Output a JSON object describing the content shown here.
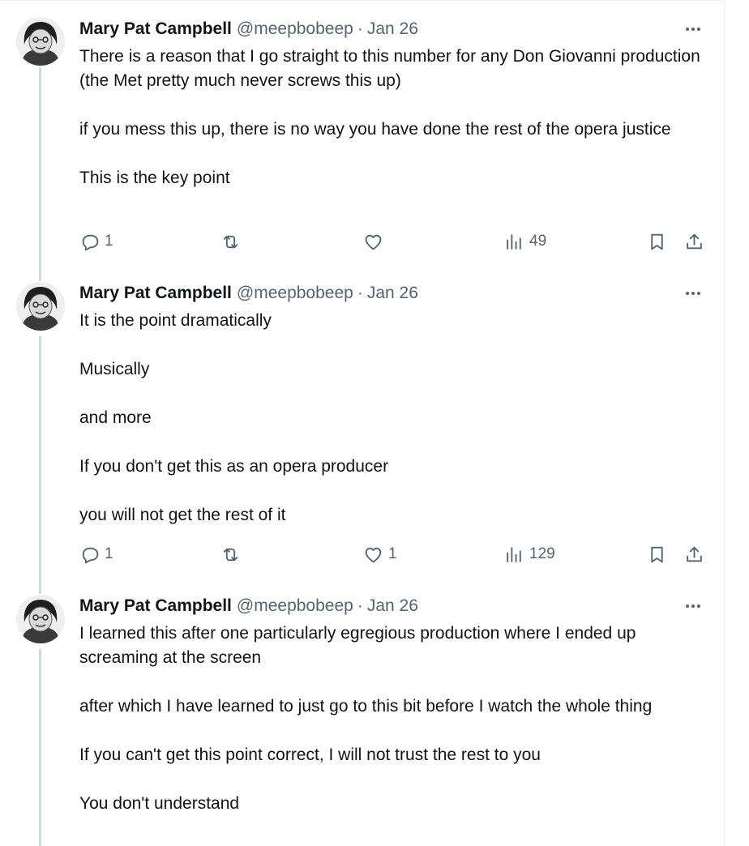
{
  "thread": [
    {
      "author": {
        "name": "Mary Pat Campbell",
        "handle": "@meepbobeep"
      },
      "separator": "·",
      "date": "Jan 26",
      "paragraphs": [
        "There is a reason that I go straight to this number for any Don Giovanni production (the Met pretty much never screws this up)",
        "if you mess this up, there is no way you have done the rest of the opera justice",
        "This is the key point"
      ],
      "replies": "1",
      "reposts": "",
      "likes": "",
      "views": "49"
    },
    {
      "author": {
        "name": "Mary Pat Campbell",
        "handle": "@meepbobeep"
      },
      "separator": "·",
      "date": "Jan 26",
      "paragraphs": [
        "It is the point dramatically",
        "Musically",
        "and more",
        "If you don't get this as an opera producer",
        "you will not get the rest of it"
      ],
      "replies": "1",
      "reposts": "",
      "likes": "1",
      "views": "129"
    },
    {
      "author": {
        "name": "Mary Pat Campbell",
        "handle": "@meepbobeep"
      },
      "separator": "·",
      "date": "Jan 26",
      "paragraphs": [
        "I learned this after one particularly egregious production where I ended up screaming at the screen",
        "after which I have learned to just go to this bit before I watch the whole thing",
        "If you can't get this point correct, I will not trust the rest to you",
        "You don't understand"
      ]
    }
  ],
  "icons": {
    "more": "more-options-icon",
    "reply": "reply-icon",
    "repost": "repost-icon",
    "like": "like-icon",
    "views": "views-icon",
    "bookmark": "bookmark-icon",
    "share": "share-icon"
  },
  "colors": {
    "text": "#0f1419",
    "muted": "#536471",
    "thread_line": "#cfd9de"
  }
}
